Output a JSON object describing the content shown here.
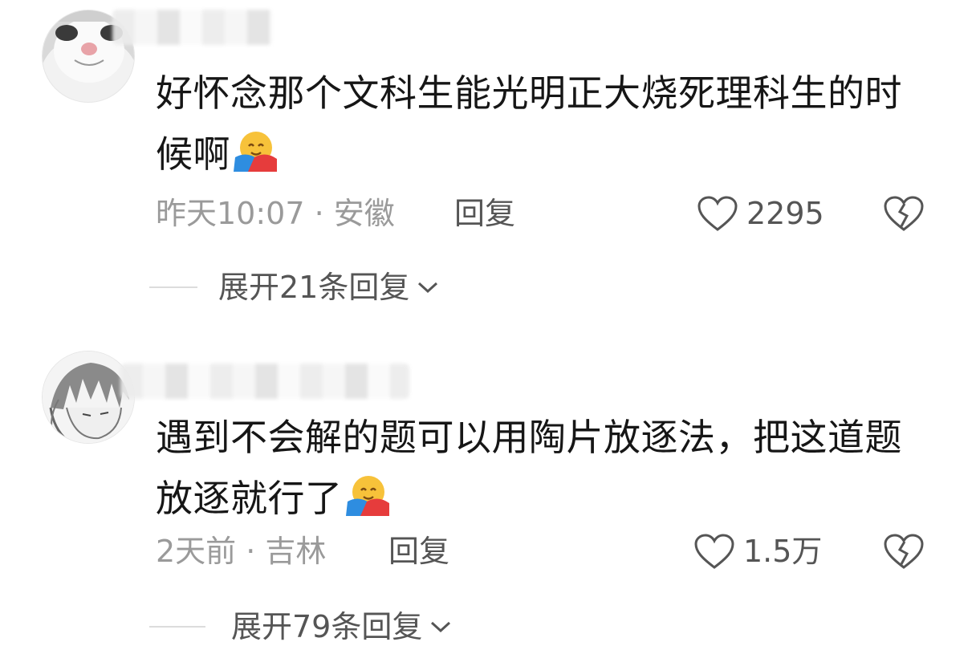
{
  "comments": [
    {
      "username": "",
      "text_line1": "好怀念那个文科生能光明正大烧死理科生的时",
      "text_line2": "候啊",
      "emoji": "hugging-face-emoji",
      "time_location": "昨天10:07 · 安徽",
      "reply_label": "回复",
      "like_count": "2295",
      "expand_label": "展开21条回复"
    },
    {
      "username": "",
      "text_line1": "遇到不会解的题可以用陶片放逐法，把这道题",
      "text_line2": "放逐就行了",
      "emoji": "hugging-face-emoji",
      "time_location": "2天前 · 吉林",
      "reply_label": "回复",
      "like_count": "1.5万",
      "expand_label": "展开79条回复"
    }
  ],
  "colors": {
    "text_primary": "#161616",
    "text_secondary": "#9a9a9a",
    "action": "#555555",
    "divider": "#dcdcdc"
  },
  "icons": [
    "heart-outline-icon",
    "broken-heart-icon",
    "chevron-down-icon"
  ]
}
